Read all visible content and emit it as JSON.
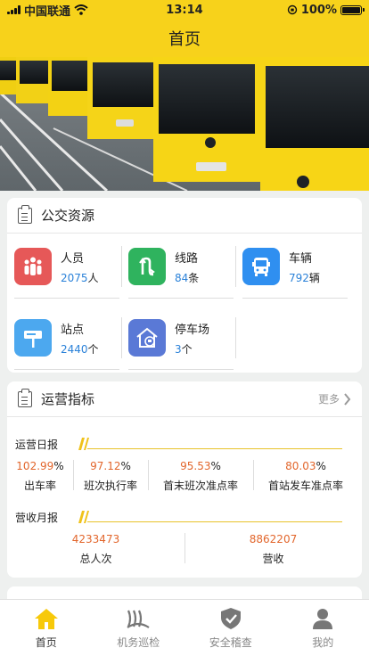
{
  "status_bar": {
    "carrier": "中国联通",
    "time": "13:14",
    "battery": "100%",
    "battery_level": 1.0
  },
  "nav": {
    "title": "首页"
  },
  "banner": {
    "image": "yellow-bus-fleet-photo"
  },
  "bus_resources": {
    "title": "公交资源",
    "items": [
      {
        "name": "人员",
        "value": "2075",
        "unit": "人",
        "icon": "people-icon",
        "color": "#e65858"
      },
      {
        "name": "线路",
        "value": "84",
        "unit": "条",
        "icon": "route-icon",
        "color": "#2fb35e"
      },
      {
        "name": "车辆",
        "value": "792",
        "unit": "辆",
        "icon": "bus-icon",
        "color": "#2f8ff0"
      },
      {
        "name": "站点",
        "value": "2440",
        "unit": "个",
        "icon": "bus-stop-icon",
        "color": "#4ca8ef"
      },
      {
        "name": "停车场",
        "value": "3",
        "unit": "个",
        "icon": "parking-lot-icon",
        "color": "#5a79d6"
      }
    ]
  },
  "operations": {
    "title": "运营指标",
    "more": "更多",
    "daily_label": "运营日报",
    "daily": [
      {
        "value": "102.99",
        "unit": "%",
        "label": "出车率"
      },
      {
        "value": "97.12",
        "unit": "%",
        "label": "班次执行率"
      },
      {
        "value": "95.53",
        "unit": "%",
        "label": "首末班次准点率"
      },
      {
        "value": "80.03",
        "unit": "%",
        "label": "首站发车准点率"
      }
    ],
    "monthly_label": "营收月报",
    "monthly": [
      {
        "value": "4233473",
        "label": "总人次"
      },
      {
        "value": "8862207",
        "label": "营收"
      }
    ]
  },
  "tabs": [
    {
      "label": "首页",
      "icon": "home-icon",
      "active": true
    },
    {
      "label": "机务巡检",
      "icon": "inspection-icon",
      "active": false
    },
    {
      "label": "安全稽查",
      "icon": "shield-check-icon",
      "active": false
    },
    {
      "label": "我的",
      "icon": "user-icon",
      "active": false
    }
  ],
  "colors": {
    "brand_yellow": "#f7d21b",
    "value_blue": "#2b82d9",
    "kpi_orange": "#e2662c"
  }
}
